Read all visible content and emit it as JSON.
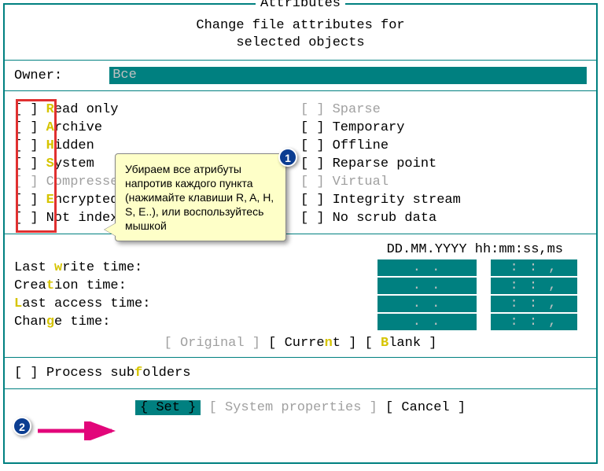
{
  "title": "Attributes",
  "subtitle1": "Change file attributes for",
  "subtitle2": "selected objects",
  "owner_label": "Owner:",
  "owner_value": "Все",
  "attrs_left": [
    {
      "hot": "R",
      "rest": "ead only",
      "disabled": false
    },
    {
      "hot": "A",
      "rest": "rchive",
      "disabled": false
    },
    {
      "hot": "H",
      "rest": "idden",
      "disabled": false
    },
    {
      "hot": "S",
      "rest": "ystem",
      "disabled": false
    },
    {
      "hot": "",
      "rest": "Compressed",
      "disabled": true
    },
    {
      "hot": "E",
      "rest": "ncrypted",
      "disabled": false
    },
    {
      "hot": "",
      "rest": "Not indexed",
      "disabled": false
    }
  ],
  "attrs_right": [
    {
      "label": "Sparse",
      "disabled": true
    },
    {
      "label": "Temporary",
      "disabled": false
    },
    {
      "label": "Offline",
      "disabled": false
    },
    {
      "label": "Reparse point",
      "disabled": false
    },
    {
      "label": "Virtual",
      "disabled": true
    },
    {
      "label": "Integrity stream",
      "disabled": false
    },
    {
      "label": "No scrub data",
      "disabled": false
    }
  ],
  "annotation_text": "Убираем все атрибуты напротив каждого пункта (нажимайте клавиши R, A, H, S, E..), или воспользуйтесь мышкой",
  "bubble1": "1",
  "bubble2": "2",
  "time_header": "DD.MM.YYYY hh:mm:ss,ms",
  "time_rows": [
    {
      "pre": "Last ",
      "hot": "w",
      "post": "rite time:"
    },
    {
      "pre": "Crea",
      "hot": "t",
      "post": "ion time:"
    },
    {
      "pre": "",
      "hot": "L",
      "post": "ast access time:"
    },
    {
      "pre": "Chan",
      "hot": "g",
      "post": "e time:"
    }
  ],
  "date_fld": " .  .    ",
  "time_fld": " :  :  , ",
  "tb_original": "[ Original ]",
  "tb_current_pre": "[ Curre",
  "tb_current_hot": "n",
  "tb_current_post": "t ]",
  "tb_blank_pre": "[ ",
  "tb_blank_hot": "B",
  "tb_blank_post": "lank ]",
  "process_sub_pre": "Process sub",
  "process_sub_hot": "f",
  "process_sub_post": "olders",
  "btn_set": "{ Set }",
  "btn_sysprop": "[ System properties ]",
  "btn_cancel": "[ Cancel ]",
  "checkbox_empty": "[ ]"
}
